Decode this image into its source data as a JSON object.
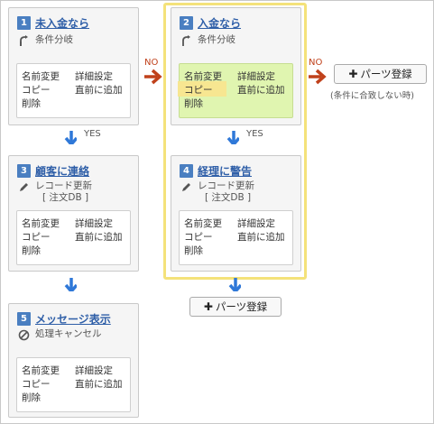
{
  "nodes": [
    {
      "num": "1",
      "title": "未入金なら",
      "sub": [
        "条件分岐"
      ]
    },
    {
      "num": "2",
      "title": "入金なら",
      "sub": [
        "条件分岐"
      ]
    },
    {
      "num": "3",
      "title": "顧客に連絡",
      "sub": [
        "レコード更新",
        "[ 注文DB ]"
      ]
    },
    {
      "num": "4",
      "title": "経理に警告",
      "sub": [
        "レコード更新",
        "[ 注文DB ]"
      ]
    },
    {
      "num": "5",
      "title": "メッセージ表示",
      "sub": [
        "処理キャンセル"
      ]
    }
  ],
  "menu": {
    "rename": "名前変更",
    "detail": "詳細設定",
    "copy": "コピー",
    "insert_before": "直前に追加",
    "delete": "削除"
  },
  "labels": {
    "yes": "YES",
    "no": "NO"
  },
  "add_part": {
    "label": "パーツ登録",
    "plus": "✚"
  },
  "note": "(条件に合致しない時)",
  "colors": {
    "accent": "#4a7fc1",
    "link": "#2f5fa8",
    "arrow_blue": "#2f78d8",
    "arrow_red": "#c0411b",
    "highlight": "#f4e27a",
    "green_menu": "#e0f5b0"
  }
}
